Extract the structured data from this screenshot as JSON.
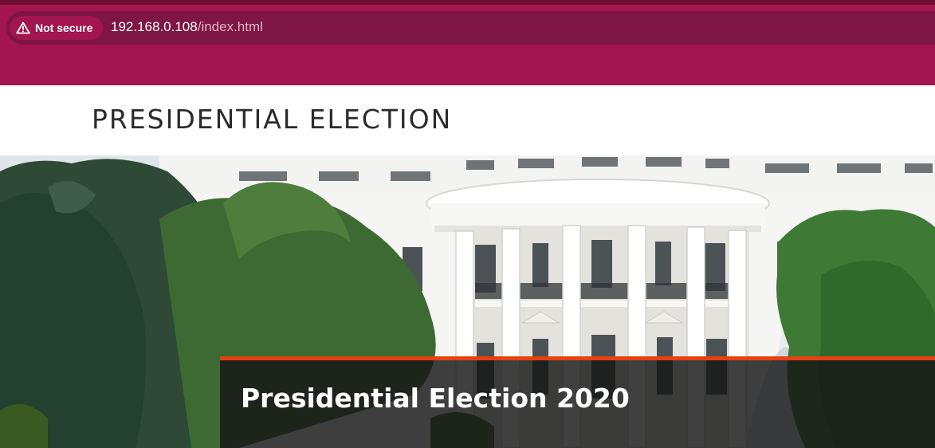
{
  "browser": {
    "security_label": "Not secure",
    "url_host": "192.168.0.108",
    "url_path": "/index.html",
    "icons": {
      "security": "warning-triangle-icon"
    },
    "colors": {
      "chrome": "#a3154d",
      "address_bar": "#7e1542"
    }
  },
  "header": {
    "site_title": "PRESIDENTIAL ELECTION"
  },
  "hero": {
    "image": "white-house-photo",
    "caption_title": "Presidential Election 2020",
    "colors": {
      "caption_accent": "#e8410f"
    }
  }
}
